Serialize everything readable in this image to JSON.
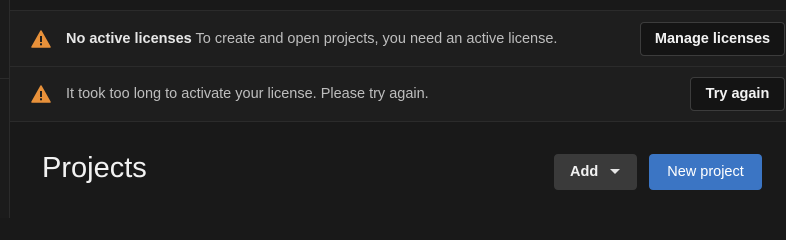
{
  "banners": [
    {
      "icon": "warning-icon",
      "title": "No active licenses",
      "message": "To create and open projects, you need an active license.",
      "button_label": "Manage licenses"
    },
    {
      "icon": "warning-icon",
      "title": "",
      "message": "It took too long to activate your license. Please try again.",
      "button_label": "Try again"
    }
  ],
  "main": {
    "title": "Projects",
    "add_label": "Add",
    "new_project_label": "New project"
  },
  "colors": {
    "background": "#191919",
    "banner_background": "#1e1e1e",
    "warning": "#e8913a",
    "primary": "#3b75c4"
  }
}
